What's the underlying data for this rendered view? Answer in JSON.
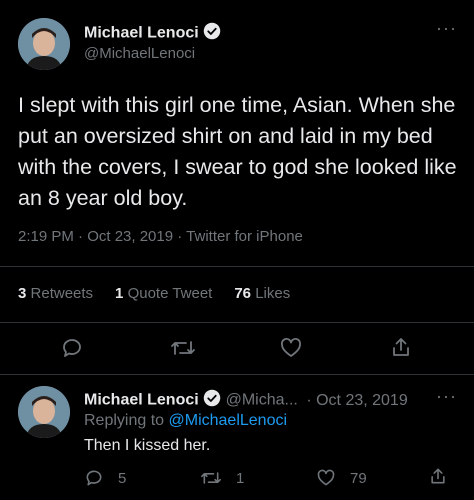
{
  "tweet": {
    "author_name": "Michael Lenoci",
    "author_handle": "@MichaelLenoci",
    "text": "I slept with this girl one time, Asian. When she put an oversized shirt on and laid in my bed with the covers, I swear to god she looked like an 8 year old boy.",
    "time": "2:19 PM · Oct 23, 2019",
    "source": "Twitter for iPhone",
    "stats": {
      "retweets_count": "3",
      "retweets_label": "Retweets",
      "quotes_count": "1",
      "quotes_label": "Quote Tweet",
      "likes_count": "76",
      "likes_label": "Likes"
    }
  },
  "reply": {
    "author_name": "Michael Lenoci",
    "author_handle": "@Micha...",
    "date": "· Oct 23, 2019",
    "replying_label": "Replying to",
    "replying_to": "@MichaelLenoci",
    "text": "Then I kissed her.",
    "actions": {
      "reply_count": "5",
      "retweet_count": "1",
      "like_count": "79"
    }
  },
  "more_glyph": "···",
  "colors": {
    "background": "#000000",
    "text": "#e7e9ea",
    "muted": "#71767b",
    "link": "#1d9bf0",
    "divider": "#2f3336"
  }
}
